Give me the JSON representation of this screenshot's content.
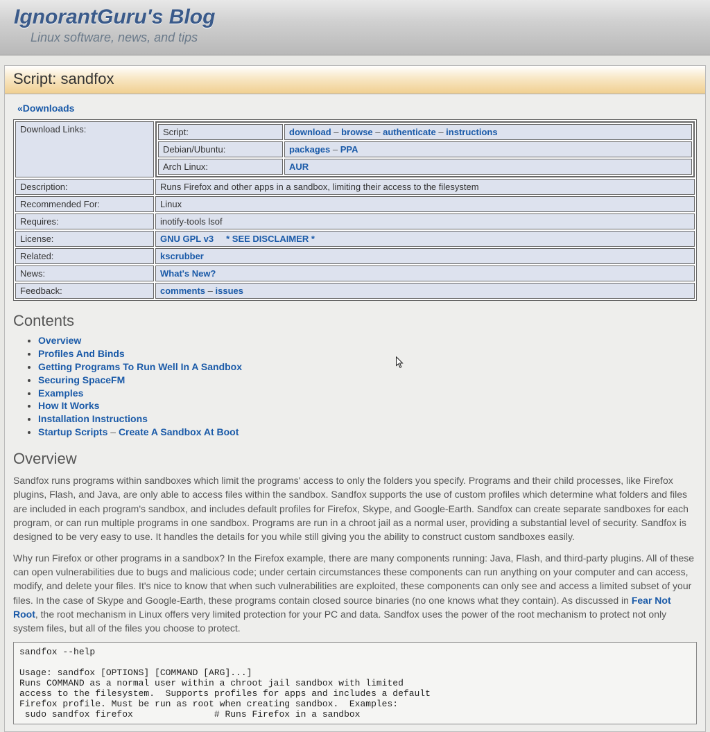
{
  "header": {
    "title": "IgnorantGuru's Blog",
    "tagline": "Linux software, news, and tips"
  },
  "page": {
    "title": "Script: sandfox",
    "downloads_back": "«Downloads"
  },
  "info": {
    "download_links_label": "Download Links:",
    "inner": {
      "script_label": "Script:",
      "script_links": {
        "download": "download",
        "browse": "browse",
        "authenticate": "authenticate",
        "instructions": "instructions"
      },
      "debian_label": "Debian/Ubuntu:",
      "debian_links": {
        "packages": "packages",
        "ppa": "PPA"
      },
      "arch_label": "Arch Linux:",
      "arch_links": {
        "aur": "AUR"
      }
    },
    "rows": {
      "description_label": "Description:",
      "description_value": "Runs Firefox and other apps in a sandbox, limiting their access to the filesystem",
      "recommended_label": "Recommended For:",
      "recommended_value": "Linux",
      "requires_label": "Requires:",
      "requires_value": "inotify-tools lsof",
      "license_label": "License:",
      "license_link": "GNU GPL v3",
      "license_disclaimer": "* SEE DISCLAIMER *",
      "related_label": "Related:",
      "related_link": "kscrubber",
      "news_label": "News:",
      "news_link": "What's New?",
      "feedback_label": "Feedback:",
      "feedback_comments": "comments",
      "feedback_issues": "issues"
    }
  },
  "contents": {
    "heading": "Contents",
    "items": {
      "overview": "Overview",
      "profiles": "Profiles And Binds",
      "getting": "Getting Programs To Run Well In A Sandbox",
      "securing": "Securing SpaceFM",
      "examples": "Examples",
      "howit": "How It Works",
      "install": "Installation Instructions",
      "startup": "Startup Scripts",
      "createboot": "Create A Sandbox At Boot"
    }
  },
  "overview": {
    "heading": "Overview",
    "p1": "Sandfox runs programs within sandboxes which limit the programs' access to only the folders you specify. Programs and their child processes, like Firefox plugins, Flash, and Java, are only able to access files within the sandbox. Sandfox supports the use of custom profiles which determine what folders and files are included in each program's sandbox, and includes default profiles for Firefox, Skype, and Google-Earth. Sandfox can create separate sandboxes for each program, or can run multiple programs in one sandbox. Programs are run in a chroot jail as a normal user, providing a substantial level of security. Sandfox is designed to be very easy to use. It handles the details for you while still giving you the ability to construct custom sandboxes easily.",
    "p2a": "Why run Firefox or other programs in a sandbox? In the Firefox example, there are many components running: Java, Flash, and third-party plugins. All of these can open vulnerabilities due to bugs and malicious code; under certain circumstances these components can run anything on your computer and can access, modify, and delete your files. It's nice to know that when such vulnerabilities are exploited, these components can only see and access a limited subset of your files. In the case of Skype and Google-Earth, these programs contain closed source binaries (no one knows what they contain). As discussed in ",
    "p2_link": "Fear Not Root",
    "p2b": ", the root mechanism in Linux offers very limited protection for your PC and data. Sandfox uses the power of the root mechanism to protect not only system files, but all of the files you choose to protect.",
    "help": "sandfox --help\n\nUsage: sandfox [OPTIONS] [COMMAND [ARG]...]\nRuns COMMAND as a normal user within a chroot jail sandbox with limited\naccess to the filesystem.  Supports profiles for apps and includes a default\nFirefox profile. Must be run as root when creating sandbox.  Examples:\n sudo sandfox firefox               # Runs Firefox in a sandbox"
  },
  "sep": " – "
}
